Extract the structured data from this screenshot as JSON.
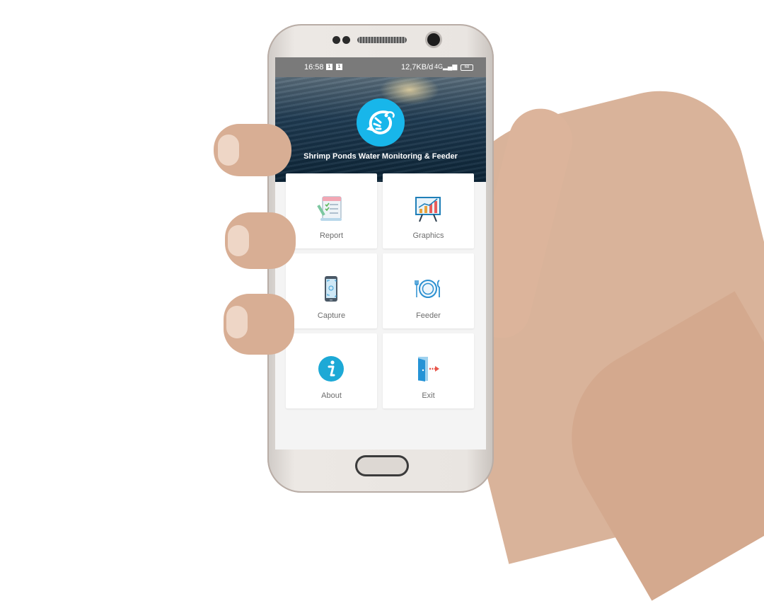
{
  "status_bar": {
    "time": "16:58",
    "notification_badge": "1",
    "network_speed": "12,7KB/d",
    "signal": "4G",
    "battery": "68"
  },
  "app": {
    "title": "Shrimp Ponds Water Monitoring & Feeder",
    "logo_icon": "shrimp-icon",
    "logo_color": "#18b6ea"
  },
  "menu": [
    {
      "label": "Report",
      "icon": "report-icon"
    },
    {
      "label": "Graphics",
      "icon": "graphics-icon"
    },
    {
      "label": "Capture",
      "icon": "capture-icon"
    },
    {
      "label": "Feeder",
      "icon": "feeder-icon"
    },
    {
      "label": "About",
      "icon": "about-icon"
    },
    {
      "label": "Exit",
      "icon": "exit-icon"
    }
  ]
}
